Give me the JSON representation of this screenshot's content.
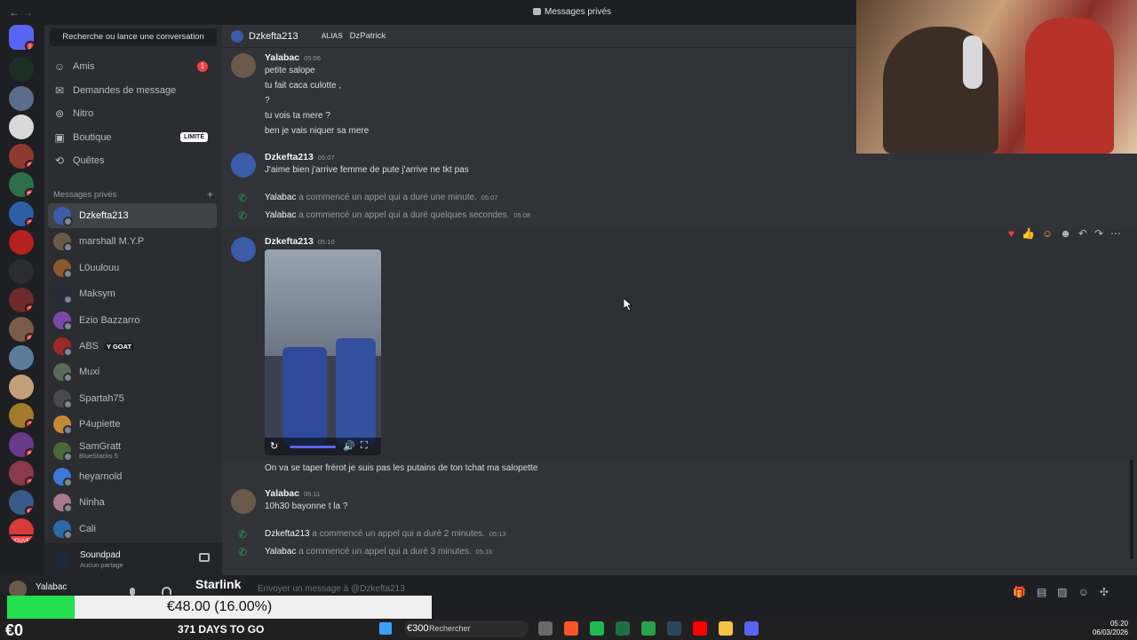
{
  "window": {
    "title": "Messages privés",
    "nav_back": "←",
    "nav_forward": "→"
  },
  "servers": [
    {
      "name": "discord-home",
      "badge": "1",
      "color": "#5865f2"
    },
    {
      "name": "server-a",
      "badge": "",
      "color": "#1a2e26"
    },
    {
      "name": "server-2",
      "badge": "",
      "color": "#5a6e8c"
    },
    {
      "name": "server-3",
      "badge": "",
      "color": "#d9d9d9"
    },
    {
      "name": "server-4",
      "badge": "9",
      "color": "#8f3a2f"
    },
    {
      "name": "server-5",
      "badge": "25",
      "color": "#2f6e4a"
    },
    {
      "name": "server-6",
      "badge": "2",
      "color": "#2b5fa8"
    },
    {
      "name": "server-7",
      "badge": "",
      "color": "#b52020"
    },
    {
      "name": "folder",
      "badge": "",
      "color": "#2b2d31"
    },
    {
      "name": "server-8",
      "badge": "2",
      "color": "#6e2a2a"
    },
    {
      "name": "server-9",
      "badge": "6",
      "color": "#7a5c4a"
    },
    {
      "name": "server-10",
      "badge": "",
      "color": "#5c7a9a"
    },
    {
      "name": "server-11",
      "badge": "",
      "color": "#c4a07a"
    },
    {
      "name": "server-12",
      "badge": "3",
      "color": "#a37a2a"
    },
    {
      "name": "server-13",
      "badge": "5",
      "color": "#6a3a8a"
    },
    {
      "name": "server-14",
      "badge": "1",
      "color": "#8a3a4a"
    },
    {
      "name": "server-15",
      "badge": "14",
      "color": "#3a5a8a"
    },
    {
      "name": "server-new",
      "badge": "NOUVEAU",
      "color": "#d93a3a"
    }
  ],
  "sidebar": {
    "search_label": "Recherche ou lance une conversation",
    "nav": [
      {
        "label": "Amis",
        "icon": "friends-icon",
        "count": "1"
      },
      {
        "label": "Demandes de message",
        "icon": "mail-icon",
        "count": ""
      },
      {
        "label": "Nitro",
        "icon": "nitro-icon",
        "count": ""
      },
      {
        "label": "Boutique",
        "icon": "shop-icon",
        "tag": "LIMITÉ"
      },
      {
        "label": "Quêtes",
        "icon": "quests-icon",
        "count": ""
      }
    ],
    "section_label": "Messages privés",
    "section_add": "+",
    "dms": [
      {
        "name": "Dzkefta213",
        "color": "#3b5ca8"
      },
      {
        "name": "marshall M.Y.P",
        "color": "#6a5a4a"
      },
      {
        "name": "L0uulouu",
        "color": "#8a5a2a"
      },
      {
        "name": "Maksym",
        "color": "#2a2a3a"
      },
      {
        "name": "Ezio Bazzarro",
        "color": "#7a4aa8"
      },
      {
        "name": "ABS",
        "color": "#9a2a2a",
        "tag": "Y GOAT"
      },
      {
        "name": "Muxi",
        "color": "#5a6a5a"
      },
      {
        "name": "Spartah75",
        "color": "#4a4a4a"
      },
      {
        "name": "P4upiette",
        "color": "#c48a3a"
      },
      {
        "name": "SamGratt",
        "color": "#4a6a3a",
        "sub": "BlueStacks 5"
      },
      {
        "name": "heyarnold",
        "color": "#3a7ad9"
      },
      {
        "name": "Ninha",
        "color": "#a87a8a"
      },
      {
        "name": "Cali",
        "color": "#2a6aa8"
      }
    ],
    "activity": {
      "title": "Soundpad",
      "status": "Aucun partage"
    },
    "user": {
      "name": "Yalabac"
    }
  },
  "chat": {
    "header_name": "Dzkefta213",
    "alias_label": "ALIAS",
    "alias_value": "DzPatrick",
    "messages": [
      {
        "author": "Yalabac",
        "time": "05:06",
        "lines": [
          "petite salope",
          "tu fait caca culotte ,",
          "?",
          "tu vois ta mere ?",
          "ben je vais niquer sa mere"
        ]
      },
      {
        "author": "Dzkefta213",
        "time": "05:07",
        "lines": [
          "J'aime bien j'arrive femme de pute j'arrive ne tkt pas"
        ]
      },
      {
        "author": "Dzkefta213",
        "time": "05:10",
        "lines": [
          "On va se taper frérot je suis pas les putains de ton tchat ma salopette"
        ]
      },
      {
        "author": "Yalabac",
        "time": "05:11",
        "lines": [
          "10h30 bayonne t la ?"
        ]
      }
    ],
    "calls": [
      {
        "author": "Yalabac",
        "text": "a commencé un appel qui a duré une minute.",
        "time": "05:07"
      },
      {
        "author": "Yalabac",
        "text": "a commencé un appel qui a duré quelques secondes.",
        "time": "05:08"
      },
      {
        "author": "Dzkefta213",
        "text": "a commencé un appel qui a duré 2 minutes.",
        "time": "05:13"
      },
      {
        "author": "Yalabac",
        "text": "a commencé un appel qui a duré 3 minutes.",
        "time": "05:16"
      }
    ],
    "composer_placeholder": "Envoyer un message à @Dzkefta213"
  },
  "overlay": {
    "starlink": "Starlink",
    "goal_label": "€48.00 (16.00%)",
    "goal_fraction": 0.16,
    "balance": "€0",
    "days": "371 DAYS TO GO"
  },
  "taskbar": {
    "search_label": "Rechercher",
    "search_overlay": "€300",
    "time": "05:20",
    "date": "06/03/2026"
  }
}
